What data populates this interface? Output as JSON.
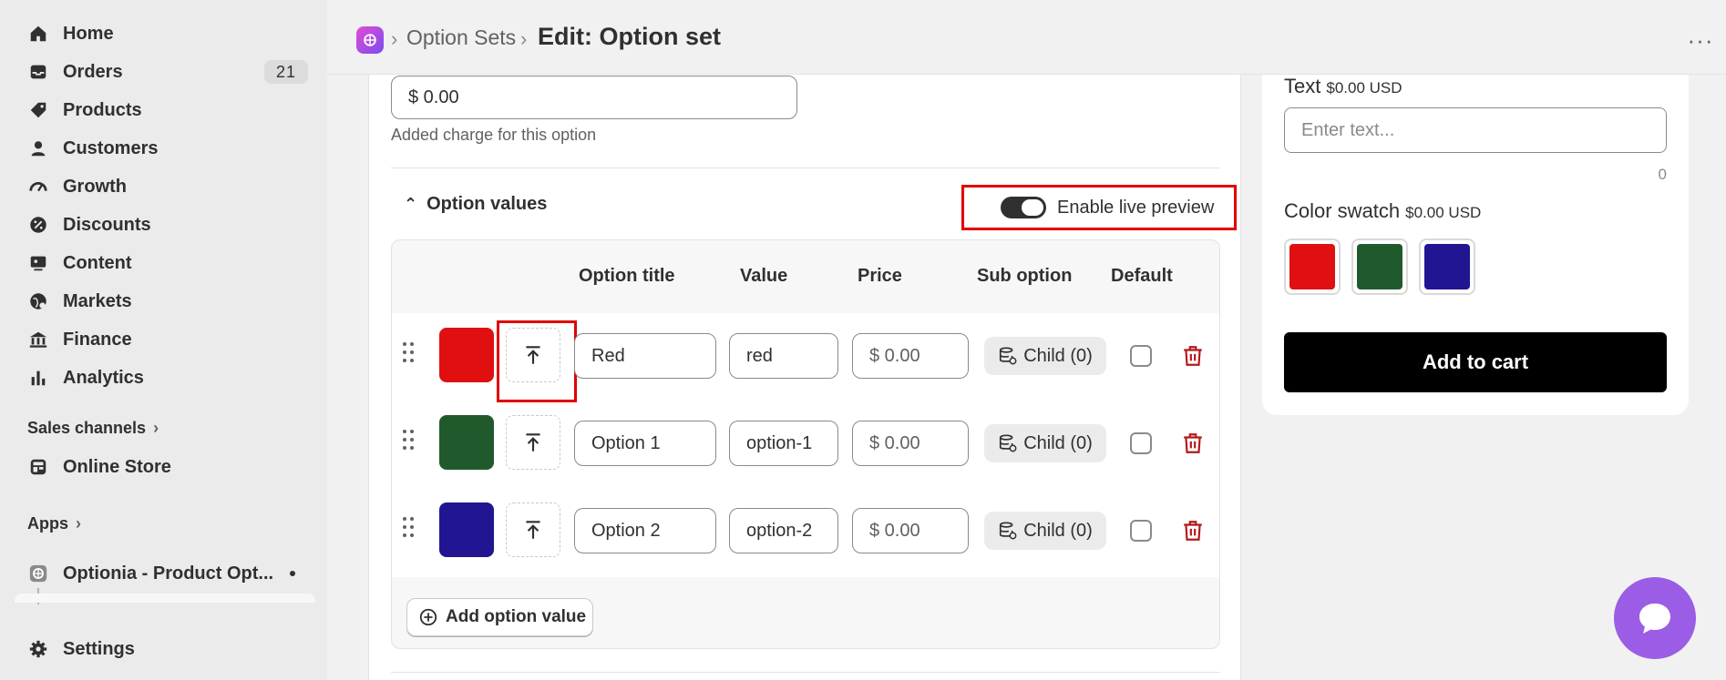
{
  "sidebar": {
    "nav": [
      {
        "label": "Home",
        "icon": "home-icon"
      },
      {
        "label": "Orders",
        "icon": "inbox-icon",
        "badge": "21"
      },
      {
        "label": "Products",
        "icon": "tag-icon"
      },
      {
        "label": "Customers",
        "icon": "person-icon"
      },
      {
        "label": "Growth",
        "icon": "gauge-icon"
      },
      {
        "label": "Discounts",
        "icon": "discount-icon"
      },
      {
        "label": "Content",
        "icon": "content-icon"
      },
      {
        "label": "Markets",
        "icon": "globe-icon"
      },
      {
        "label": "Finance",
        "icon": "bank-icon"
      },
      {
        "label": "Analytics",
        "icon": "bar-chart-icon"
      }
    ],
    "sales_channels_label": "Sales channels",
    "online_store_label": "Online Store",
    "apps_label": "Apps",
    "app_label": "Optionia - Product Opt...",
    "settings_label": "Settings"
  },
  "header": {
    "breadcrumb_parent": "Option Sets",
    "title": "Edit: Option set",
    "more_label": "···"
  },
  "editor": {
    "charge_value": "$ 0.00",
    "charge_help": "Added charge for this option",
    "option_values_label": "Option values",
    "live_preview_label": "Enable live preview",
    "live_preview_on": true,
    "columns": [
      "Option title",
      "Value",
      "Price",
      "Sub option",
      "Default"
    ],
    "rows": [
      {
        "swatch": "#e01010",
        "title": "Red",
        "value": "red",
        "price": "$ 0.00",
        "sub_option": "Child (0)",
        "default": false
      },
      {
        "swatch": "#205a2c",
        "title": "Option 1",
        "value": "option-1",
        "price": "$ 0.00",
        "sub_option": "Child (0)",
        "default": false
      },
      {
        "swatch": "#211592",
        "title": "Option 2",
        "value": "option-2",
        "price": "$ 0.00",
        "sub_option": "Child (0)",
        "default": false
      }
    ],
    "add_option_value_label": "Add option value"
  },
  "preview": {
    "text_label": "Text",
    "text_price": "$0.00 USD",
    "text_placeholder": "Enter text...",
    "char_count": "0",
    "swatch_label": "Color swatch",
    "swatch_price": "$0.00 USD",
    "swatches": [
      "#e01010",
      "#205a2c",
      "#211592"
    ],
    "add_to_cart_label": "Add to cart"
  },
  "colors": {
    "highlight": "#e00000",
    "chat": "#9b5de5",
    "delete": "#b21a1a"
  }
}
